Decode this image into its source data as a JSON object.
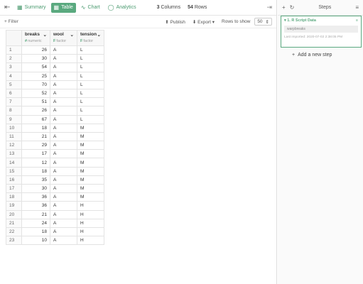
{
  "topbar": {
    "tabs": [
      {
        "label": "Summary",
        "icon": "summary-icon"
      },
      {
        "label": "Table",
        "icon": "table-icon"
      },
      {
        "label": "Chart",
        "icon": "chart-icon"
      },
      {
        "label": "Analytics",
        "icon": "lightbulb-icon"
      }
    ],
    "columns_count": "3",
    "columns_label": "Columns",
    "rows_count": "54",
    "rows_label": "Rows"
  },
  "toolbar": {
    "filter_label": "Filter",
    "publish_label": "Publish",
    "export_label": "Export",
    "rows_to_show_label": "Rows to show",
    "rows_to_show_value": "50"
  },
  "table": {
    "columns": [
      {
        "name": "breaks",
        "type_letter": "#",
        "type": "numeric"
      },
      {
        "name": "wool",
        "type_letter": "F",
        "type": "factor"
      },
      {
        "name": "tension",
        "type_letter": "F",
        "type": "factor"
      }
    ],
    "rows": [
      [
        "1",
        "26",
        "A",
        "L"
      ],
      [
        "2",
        "30",
        "A",
        "L"
      ],
      [
        "3",
        "54",
        "A",
        "L"
      ],
      [
        "4",
        "25",
        "A",
        "L"
      ],
      [
        "5",
        "70",
        "A",
        "L"
      ],
      [
        "6",
        "52",
        "A",
        "L"
      ],
      [
        "7",
        "51",
        "A",
        "L"
      ],
      [
        "8",
        "26",
        "A",
        "L"
      ],
      [
        "9",
        "67",
        "A",
        "L"
      ],
      [
        "10",
        "18",
        "A",
        "M"
      ],
      [
        "11",
        "21",
        "A",
        "M"
      ],
      [
        "12",
        "29",
        "A",
        "M"
      ],
      [
        "13",
        "17",
        "A",
        "M"
      ],
      [
        "14",
        "12",
        "A",
        "M"
      ],
      [
        "15",
        "18",
        "A",
        "M"
      ],
      [
        "16",
        "35",
        "A",
        "M"
      ],
      [
        "17",
        "30",
        "A",
        "M"
      ],
      [
        "18",
        "36",
        "A",
        "M"
      ],
      [
        "19",
        "36",
        "A",
        "H"
      ],
      [
        "20",
        "21",
        "A",
        "H"
      ],
      [
        "21",
        "24",
        "A",
        "H"
      ],
      [
        "22",
        "18",
        "A",
        "H"
      ],
      [
        "23",
        "10",
        "A",
        "H"
      ]
    ]
  },
  "steps": {
    "title": "Steps",
    "items": [
      {
        "label": "1. R Script Data",
        "code": "warpbreaks",
        "last_imported": "Last imported: 2020-07-02 2:38:05 PM"
      }
    ],
    "add_label": "Add a new step"
  },
  "colors": {
    "accent": "#5aa97f"
  }
}
